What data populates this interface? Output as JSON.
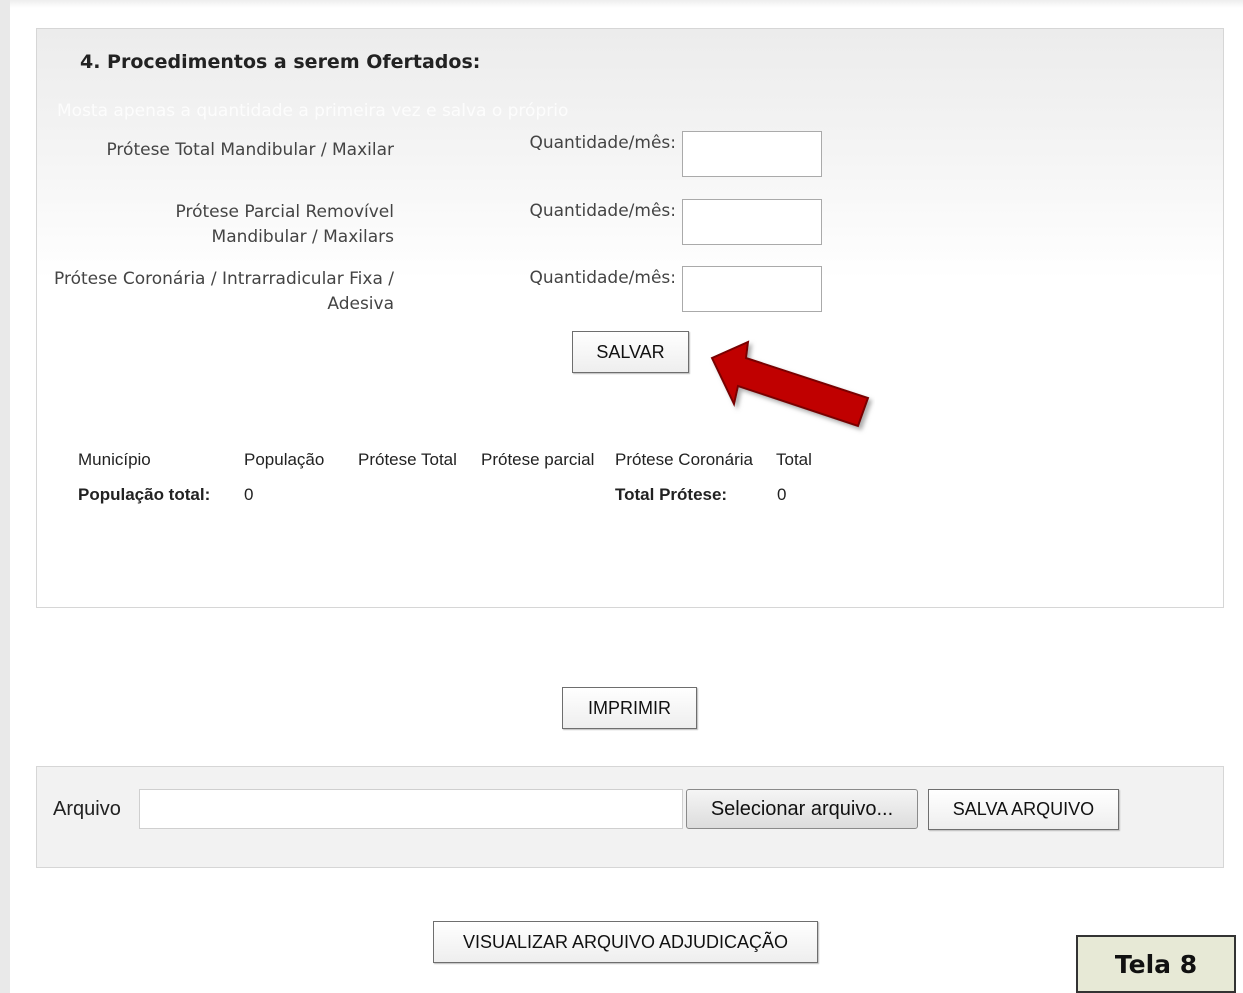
{
  "section": {
    "title": "4. Procedimentos a serem Ofertados:",
    "note": "Mosta apenas a quantidade a primeira vez e salva o próprio"
  },
  "procedures": [
    {
      "label": "Prótese Total Mandibular / Maxilar",
      "qty_label": "Quantidade/mês:",
      "qty_value": ""
    },
    {
      "label": "Prótese Parcial Removível Mandibular / Maxilars",
      "qty_label": "Quantidade/mês:",
      "qty_value": ""
    },
    {
      "label": "Prótese Coronária / Intrarradicular Fixa / Adesiva",
      "qty_label": "Quantidade/mês:",
      "qty_value": ""
    }
  ],
  "buttons": {
    "salvar": "SALVAR",
    "imprimir": "IMPRIMIR",
    "selecionar": "Selecionar arquivo...",
    "salva_arquivo": "SALVA ARQUIVO",
    "visualizar": "VISUALIZAR ARQUIVO ADJUDICAÇÃO"
  },
  "table": {
    "headers": [
      "Município",
      "População",
      "Prótese Total",
      "Prótese parcial",
      "Prótese Coronária",
      "Total"
    ],
    "populacao_total_label": "População total:",
    "populacao_total_value": "0",
    "total_protese_label": "Total Prótese:",
    "total_protese_value": "0"
  },
  "file": {
    "label": "Arquivo",
    "value": ""
  },
  "badge": "Tela 8",
  "colors": {
    "arrow": "#c00000",
    "badge_bg": "#e7e9d6"
  },
  "icons": [
    "red-arrow-icon"
  ]
}
